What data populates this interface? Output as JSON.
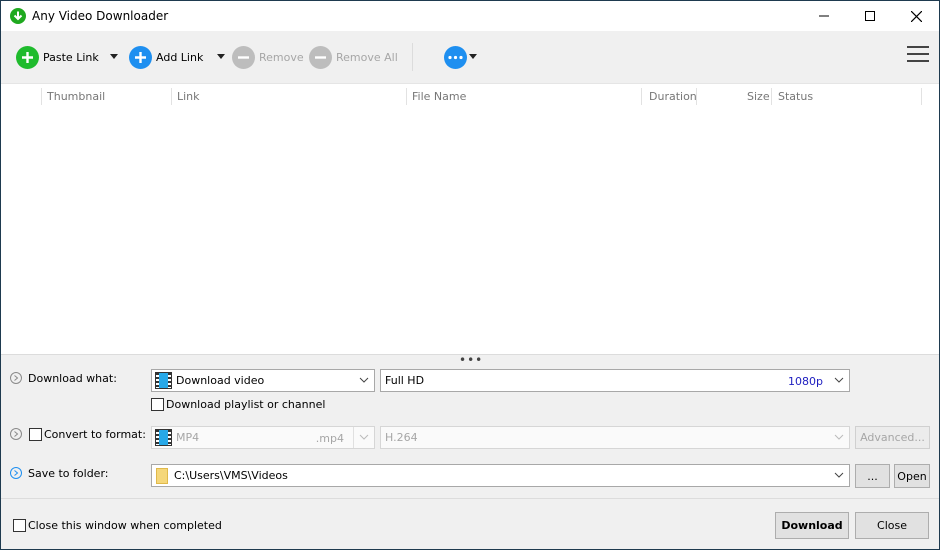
{
  "window": {
    "title": "Any Video Downloader",
    "controls": {
      "minimize": "minimize",
      "maximize": "maximize",
      "close": "close"
    }
  },
  "toolbar": {
    "paste_link": "Paste Link",
    "add_link": "Add Link",
    "remove": "Remove",
    "remove_all": "Remove All",
    "more_icon": "more-options-icon",
    "menu_icon": "hamburger-menu-icon"
  },
  "list": {
    "columns": [
      "Thumbnail",
      "Link",
      "File Name",
      "Duration",
      "Size",
      "Status"
    ],
    "rows": []
  },
  "options": {
    "download_what": {
      "label": "Download what:",
      "type_value": "Download video",
      "quality_value": "Full HD",
      "quality_resolution": "1080p",
      "playlist_label": "Download playlist or channel",
      "playlist_checked": false
    },
    "convert": {
      "label": "Convert to format:",
      "checked": false,
      "format_value": "MP4",
      "format_ext": ".mp4",
      "codec_value": "H.264",
      "advanced_label": "Advanced..."
    },
    "save": {
      "label": "Save to folder:",
      "path": "C:\\Users\\VMS\\Videos",
      "browse_label": "...",
      "open_label": "Open"
    }
  },
  "footer": {
    "close_when_done_label": "Close this window when completed",
    "close_when_done_checked": false,
    "download_label": "Download",
    "close_label": "Close"
  },
  "colors": {
    "accent_green": "#1fbb2d",
    "accent_blue": "#1e8ff0",
    "resolution_text": "#2020c0"
  }
}
